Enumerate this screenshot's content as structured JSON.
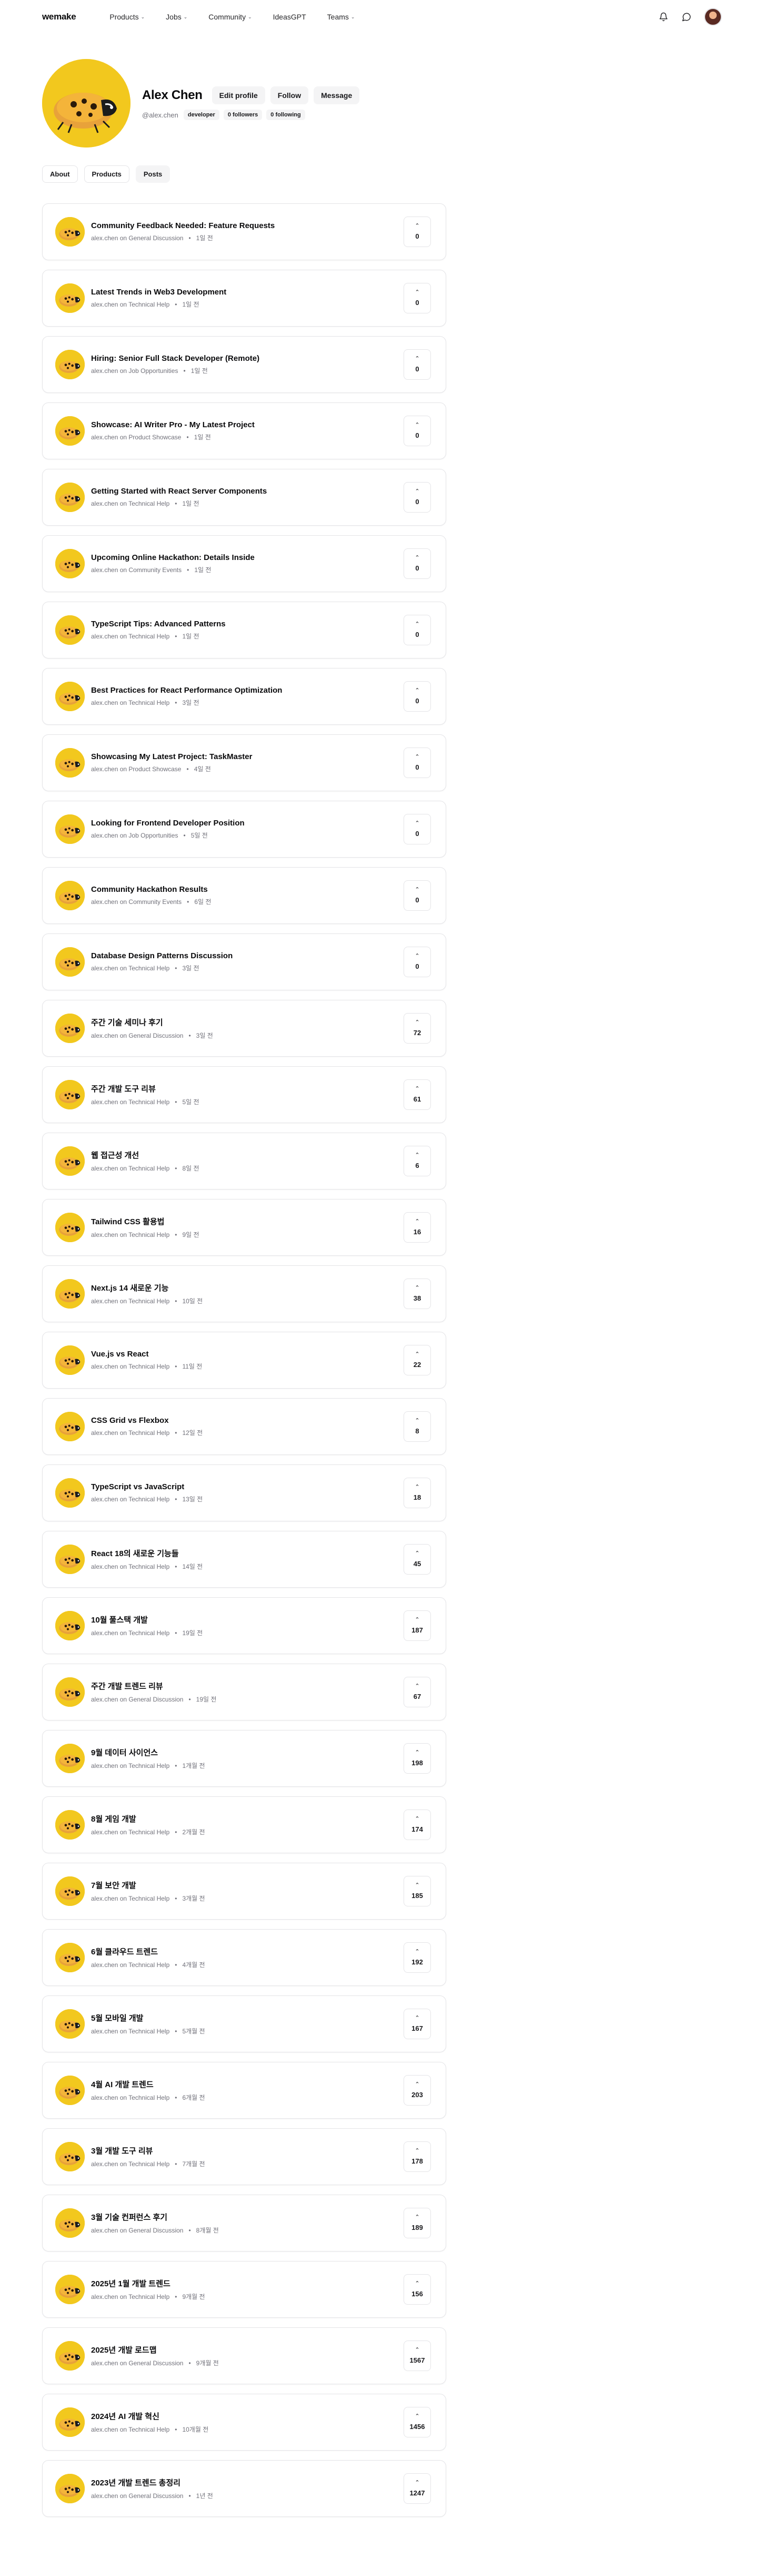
{
  "nav": {
    "logo": "wemake",
    "menu": [
      {
        "label": "Products",
        "has_dropdown": true
      },
      {
        "label": "Jobs",
        "has_dropdown": true
      },
      {
        "label": "Community",
        "has_dropdown": true
      },
      {
        "label": "IdeasGPT",
        "has_dropdown": false
      },
      {
        "label": "Teams",
        "has_dropdown": true
      }
    ],
    "icons": [
      "bell-icon",
      "message-icon"
    ]
  },
  "profile": {
    "name": "Alex Chen",
    "handle": "@alex.chen",
    "buttons": {
      "edit": "Edit profile",
      "follow": "Follow",
      "message": "Message"
    },
    "chips": {
      "role": "developer",
      "followers": "0 followers",
      "following": "0 following"
    }
  },
  "tabs": [
    {
      "label": "About",
      "active": false
    },
    {
      "label": "Products",
      "active": false
    },
    {
      "label": "Posts",
      "active": true
    }
  ],
  "posts": [
    {
      "title": "Community Feedback Needed: Feature Requests",
      "author": "alex.chen",
      "on": "on",
      "category": "General Discussion",
      "time": "1일 전",
      "votes": "0"
    },
    {
      "title": "Latest Trends in Web3 Development",
      "author": "alex.chen",
      "on": "on",
      "category": "Technical Help",
      "time": "1일 전",
      "votes": "0"
    },
    {
      "title": "Hiring: Senior Full Stack Developer (Remote)",
      "author": "alex.chen",
      "on": "on",
      "category": "Job Opportunities",
      "time": "1일 전",
      "votes": "0"
    },
    {
      "title": "Showcase: AI Writer Pro - My Latest Project",
      "author": "alex.chen",
      "on": "on",
      "category": "Product Showcase",
      "time": "1일 전",
      "votes": "0"
    },
    {
      "title": "Getting Started with React Server Components",
      "author": "alex.chen",
      "on": "on",
      "category": "Technical Help",
      "time": "1일 전",
      "votes": "0"
    },
    {
      "title": "Upcoming Online Hackathon: Details Inside",
      "author": "alex.chen",
      "on": "on",
      "category": "Community Events",
      "time": "1일 전",
      "votes": "0"
    },
    {
      "title": "TypeScript Tips: Advanced Patterns",
      "author": "alex.chen",
      "on": "on",
      "category": "Technical Help",
      "time": "1일 전",
      "votes": "0"
    },
    {
      "title": "Best Practices for React Performance Optimization",
      "author": "alex.chen",
      "on": "on",
      "category": "Technical Help",
      "time": "3일 전",
      "votes": "0"
    },
    {
      "title": "Showcasing My Latest Project: TaskMaster",
      "author": "alex.chen",
      "on": "on",
      "category": "Product Showcase",
      "time": "4일 전",
      "votes": "0"
    },
    {
      "title": "Looking for Frontend Developer Position",
      "author": "alex.chen",
      "on": "on",
      "category": "Job Opportunities",
      "time": "5일 전",
      "votes": "0"
    },
    {
      "title": "Community Hackathon Results",
      "author": "alex.chen",
      "on": "on",
      "category": "Community Events",
      "time": "6일 전",
      "votes": "0"
    },
    {
      "title": "Database Design Patterns Discussion",
      "author": "alex.chen",
      "on": "on",
      "category": "Technical Help",
      "time": "3일 전",
      "votes": "0"
    },
    {
      "title": "주간 기술 세미나 후기",
      "author": "alex.chen",
      "on": "on",
      "category": "General Discussion",
      "time": "3일 전",
      "votes": "72"
    },
    {
      "title": "주간 개발 도구 리뷰",
      "author": "alex.chen",
      "on": "on",
      "category": "Technical Help",
      "time": "5일 전",
      "votes": "61"
    },
    {
      "title": "웹 접근성 개선",
      "author": "alex.chen",
      "on": "on",
      "category": "Technical Help",
      "time": "8일 전",
      "votes": "6"
    },
    {
      "title": "Tailwind CSS 활용법",
      "author": "alex.chen",
      "on": "on",
      "category": "Technical Help",
      "time": "9일 전",
      "votes": "16"
    },
    {
      "title": "Next.js 14 새로운 기능",
      "author": "alex.chen",
      "on": "on",
      "category": "Technical Help",
      "time": "10일 전",
      "votes": "38"
    },
    {
      "title": "Vue.js vs React",
      "author": "alex.chen",
      "on": "on",
      "category": "Technical Help",
      "time": "11일 전",
      "votes": "22"
    },
    {
      "title": "CSS Grid vs Flexbox",
      "author": "alex.chen",
      "on": "on",
      "category": "Technical Help",
      "time": "12일 전",
      "votes": "8"
    },
    {
      "title": "TypeScript vs JavaScript",
      "author": "alex.chen",
      "on": "on",
      "category": "Technical Help",
      "time": "13일 전",
      "votes": "18"
    },
    {
      "title": "React 18의 새로운 기능들",
      "author": "alex.chen",
      "on": "on",
      "category": "Technical Help",
      "time": "14일 전",
      "votes": "45"
    },
    {
      "title": "10월 풀스택 개발",
      "author": "alex.chen",
      "on": "on",
      "category": "Technical Help",
      "time": "19일 전",
      "votes": "187"
    },
    {
      "title": "주간 개발 트렌드 리뷰",
      "author": "alex.chen",
      "on": "on",
      "category": "General Discussion",
      "time": "19일 전",
      "votes": "67"
    },
    {
      "title": "9월 데이터 사이언스",
      "author": "alex.chen",
      "on": "on",
      "category": "Technical Help",
      "time": "1개월 전",
      "votes": "198"
    },
    {
      "title": "8월 게임 개발",
      "author": "alex.chen",
      "on": "on",
      "category": "Technical Help",
      "time": "2개월 전",
      "votes": "174"
    },
    {
      "title": "7월 보안 개발",
      "author": "alex.chen",
      "on": "on",
      "category": "Technical Help",
      "time": "3개월 전",
      "votes": "185"
    },
    {
      "title": "6월 클라우드 트렌드",
      "author": "alex.chen",
      "on": "on",
      "category": "Technical Help",
      "time": "4개월 전",
      "votes": "192"
    },
    {
      "title": "5월 모바일 개발",
      "author": "alex.chen",
      "on": "on",
      "category": "Technical Help",
      "time": "5개월 전",
      "votes": "167"
    },
    {
      "title": "4월 AI 개발 트렌드",
      "author": "alex.chen",
      "on": "on",
      "category": "Technical Help",
      "time": "6개월 전",
      "votes": "203"
    },
    {
      "title": "3월 개발 도구 리뷰",
      "author": "alex.chen",
      "on": "on",
      "category": "Technical Help",
      "time": "7개월 전",
      "votes": "178"
    },
    {
      "title": "3월 기술 컨퍼런스 후기",
      "author": "alex.chen",
      "on": "on",
      "category": "General Discussion",
      "time": "8개월 전",
      "votes": "189"
    },
    {
      "title": "2025년 1월 개발 트렌드",
      "author": "alex.chen",
      "on": "on",
      "category": "Technical Help",
      "time": "9개월 전",
      "votes": "156"
    },
    {
      "title": "2025년 개발 로드맵",
      "author": "alex.chen",
      "on": "on",
      "category": "General Discussion",
      "time": "9개월 전",
      "votes": "1567"
    },
    {
      "title": "2024년 AI 개발 혁신",
      "author": "alex.chen",
      "on": "on",
      "category": "Technical Help",
      "time": "10개월 전",
      "votes": "1456"
    },
    {
      "title": "2023년 개발 트렌드 총정리",
      "author": "alex.chen",
      "on": "on",
      "category": "General Discussion",
      "time": "1년 전",
      "votes": "1247"
    }
  ]
}
